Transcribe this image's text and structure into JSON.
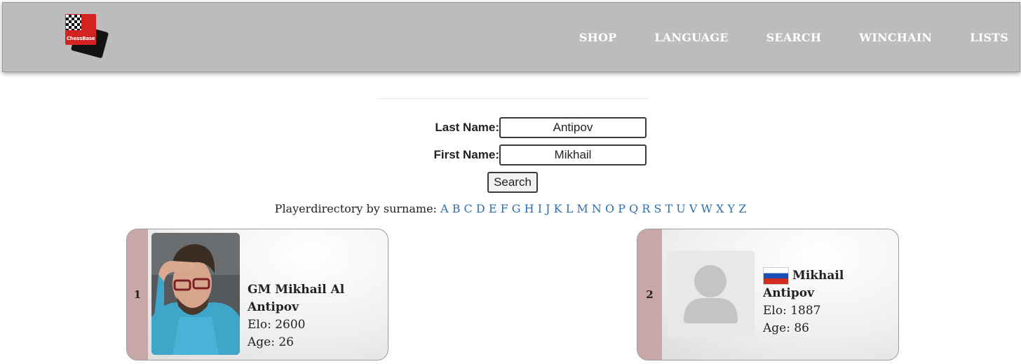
{
  "header": {
    "logo_text": "ChessBase",
    "nav": [
      "SHOP",
      "LANGUAGE",
      "SEARCH",
      "WINCHAIN",
      "LISTS"
    ]
  },
  "form": {
    "last_name_label": "Last Name:",
    "last_name_value": "Antipov",
    "first_name_label": "First Name:",
    "first_name_value": "Mikhail",
    "search_button": "Search"
  },
  "directory": {
    "label": "Playerdirectory by surname:",
    "letters": [
      "A",
      "B",
      "C",
      "D",
      "E",
      "F",
      "G",
      "H",
      "I",
      "J",
      "K",
      "L",
      "M",
      "N",
      "O",
      "P",
      "Q",
      "R",
      "S",
      "T",
      "U",
      "V",
      "W",
      "X",
      "Y",
      "Z"
    ]
  },
  "results": [
    {
      "rank": "1",
      "name": "GM Mikhail Al Antipov",
      "elo": "Elo: 2600",
      "age": "Age: 26"
    },
    {
      "rank": "2",
      "name": "Mikhail Antipov",
      "elo": "Elo: 1887",
      "age": "Age: 86",
      "flag": "russia-flag"
    }
  ]
}
